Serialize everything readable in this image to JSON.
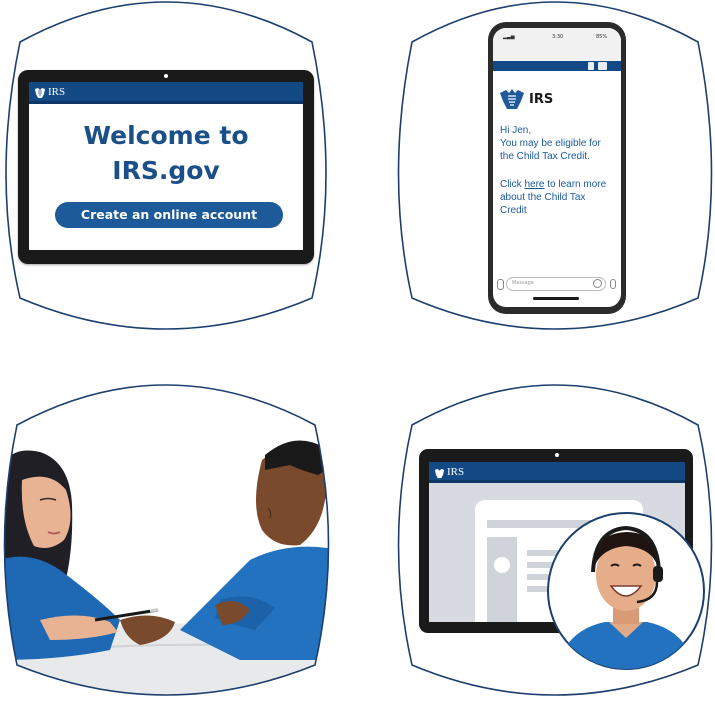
{
  "panel1": {
    "brand": "IRS",
    "headline_line1": "Welcome to",
    "headline_line2": "IRS.gov",
    "button_label": "Create an online account"
  },
  "panel2": {
    "status_time": "3:30",
    "status_battery": "85%",
    "brand": "IRS",
    "greeting": "Hi Jen,",
    "line1": "You may be eligible for",
    "line2": "the Child Tax Credit.",
    "click_prefix": "Click ",
    "link_text": "here",
    "click_suffix": " to learn more",
    "line4": "about the Child Tax",
    "line5": "Credit",
    "input_placeholder": "Message"
  },
  "panel4": {
    "brand": "IRS"
  },
  "colors": {
    "irs_blue": "#134a86",
    "outline": "#1c3f6e",
    "headline": "#1b4f8a",
    "button": "#1c5a9a"
  }
}
